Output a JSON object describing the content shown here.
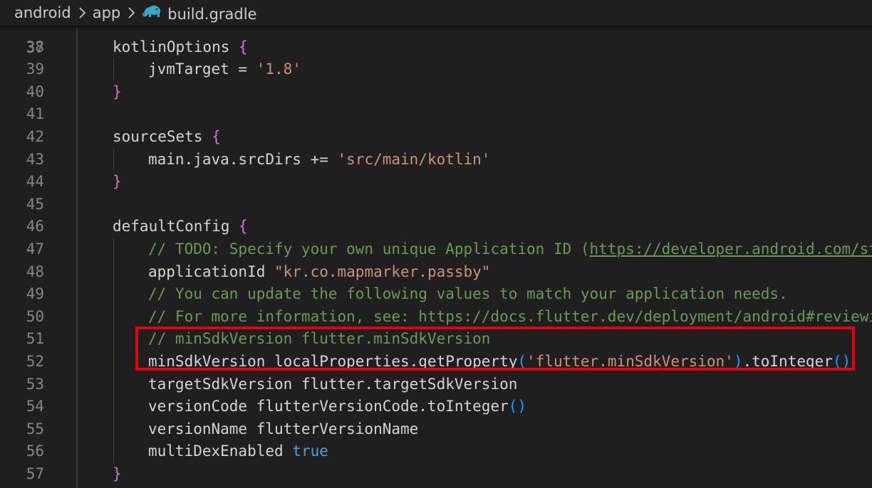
{
  "breadcrumb": {
    "items": [
      {
        "label": "android",
        "icon": null
      },
      {
        "label": "app",
        "icon": null
      },
      {
        "label": "build.gradle",
        "icon": "gradle-elephant-icon"
      }
    ],
    "separator_icon": "chevron-right-icon"
  },
  "editor": {
    "partial_top_line": "37",
    "lines": [
      {
        "n": "38",
        "indent": 0,
        "tokens": [
          {
            "t": "kotlinOptions ",
            "c": "plain"
          },
          {
            "t": "{",
            "c": "brace"
          }
        ]
      },
      {
        "n": "39",
        "indent": 1,
        "tokens": [
          {
            "t": "jvmTarget = ",
            "c": "plain"
          },
          {
            "t": "'1.8'",
            "c": "str"
          }
        ]
      },
      {
        "n": "40",
        "indent": 0,
        "tokens": [
          {
            "t": "}",
            "c": "brace"
          }
        ]
      },
      {
        "n": "41",
        "indent": 0,
        "tokens": []
      },
      {
        "n": "42",
        "indent": 0,
        "tokens": [
          {
            "t": "sourceSets ",
            "c": "plain"
          },
          {
            "t": "{",
            "c": "brace"
          }
        ]
      },
      {
        "n": "43",
        "indent": 1,
        "tokens": [
          {
            "t": "main.java.srcDirs += ",
            "c": "plain"
          },
          {
            "t": "'src/main/kotlin'",
            "c": "str"
          }
        ]
      },
      {
        "n": "44",
        "indent": 0,
        "tokens": [
          {
            "t": "}",
            "c": "brace"
          }
        ]
      },
      {
        "n": "45",
        "indent": 0,
        "tokens": []
      },
      {
        "n": "46",
        "indent": 0,
        "tokens": [
          {
            "t": "defaultConfig ",
            "c": "plain"
          },
          {
            "t": "{",
            "c": "brace"
          }
        ]
      },
      {
        "n": "47",
        "indent": 1,
        "tokens": [
          {
            "t": "// TODO: Specify your own unique Application ID (",
            "c": "com"
          },
          {
            "t": "https://developer.android.com/st",
            "c": "link"
          }
        ]
      },
      {
        "n": "48",
        "indent": 1,
        "tokens": [
          {
            "t": "applicationId ",
            "c": "plain"
          },
          {
            "t": "\"kr.co.mapmarker.passby\"",
            "c": "str"
          }
        ]
      },
      {
        "n": "49",
        "indent": 1,
        "tokens": [
          {
            "t": "// You can update the following values to match your application needs.",
            "c": "com"
          }
        ]
      },
      {
        "n": "50",
        "indent": 1,
        "tokens": [
          {
            "t": "// For more information, see: https://docs.flutter.dev/deployment/android#reviewi",
            "c": "com"
          }
        ]
      },
      {
        "n": "51",
        "indent": 1,
        "tokens": [
          {
            "t": "// minSdkVersion flutter.minSdkVersion",
            "c": "com"
          }
        ]
      },
      {
        "n": "52",
        "indent": 1,
        "tokens": [
          {
            "t": "minSdkVersion localProperties.getProperty",
            "c": "plain"
          },
          {
            "t": "(",
            "c": "paren"
          },
          {
            "t": "'flutter.minSdkVersion'",
            "c": "str"
          },
          {
            "t": ")",
            "c": "paren"
          },
          {
            "t": ".toInteger",
            "c": "plain"
          },
          {
            "t": "()",
            "c": "paren"
          }
        ]
      },
      {
        "n": "53",
        "indent": 1,
        "tokens": [
          {
            "t": "targetSdkVersion flutter.targetSdkVersion",
            "c": "plain"
          }
        ]
      },
      {
        "n": "54",
        "indent": 1,
        "tokens": [
          {
            "t": "versionCode flutterVersionCode.toInteger",
            "c": "plain"
          },
          {
            "t": "()",
            "c": "paren"
          }
        ]
      },
      {
        "n": "55",
        "indent": 1,
        "tokens": [
          {
            "t": "versionName flutterVersionName",
            "c": "plain"
          }
        ]
      },
      {
        "n": "56",
        "indent": 1,
        "tokens": [
          {
            "t": "multiDexEnabled ",
            "c": "plain"
          },
          {
            "t": "true",
            "c": "kw"
          }
        ]
      },
      {
        "n": "57",
        "indent": 0,
        "tokens": [
          {
            "t": "}",
            "c": "brace"
          }
        ]
      }
    ]
  },
  "colors": {
    "background": "#1f1f1f",
    "line_number": "#858585",
    "plain": "#d4d4d4",
    "brace": "#da70d6",
    "paren": "#179fff",
    "string": "#ce9178",
    "comment": "#6a9955",
    "keyword": "#569cd6",
    "highlight_box": "#e3000f"
  }
}
